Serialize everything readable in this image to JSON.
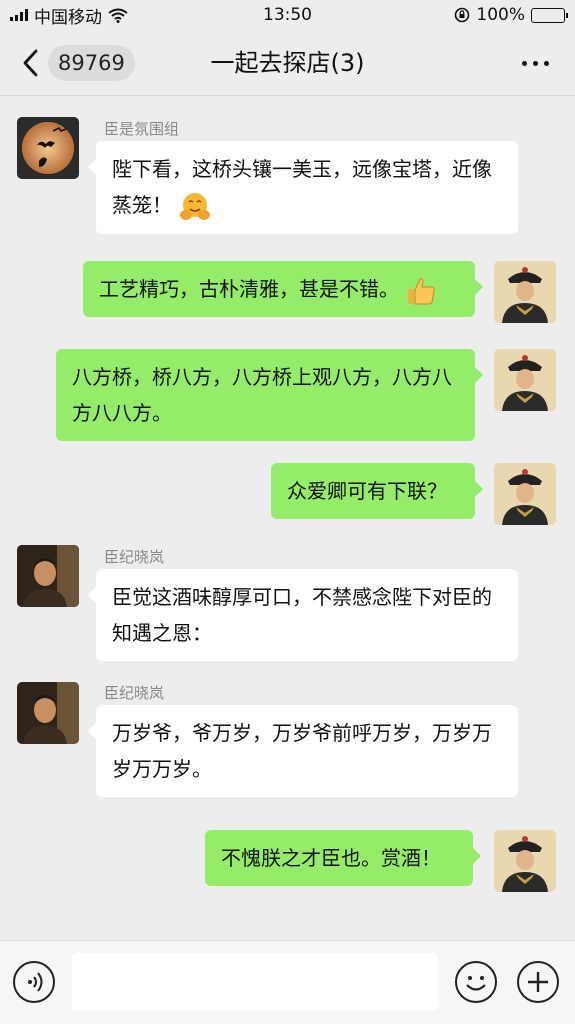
{
  "status_bar": {
    "carrier": "中国移动",
    "time": "13:50",
    "battery": "100%",
    "battery_level": 1.0
  },
  "nav": {
    "unread_count": "89769",
    "title": "一起去探店(3)"
  },
  "messages": [
    {
      "sender": "臣是氛围组",
      "text": "陛下看，这桥头镶一美玉，远像宝塔，近像蒸笼！",
      "emoji": "hug-face",
      "direction": "in"
    },
    {
      "text": "工艺精巧，古朴清雅，甚是不错。",
      "emoji": "thumbs-up",
      "direction": "out"
    },
    {
      "text": "八方桥，桥八方，八方桥上观八方，八方八方八八方。",
      "direction": "out"
    },
    {
      "text": "众爱卿可有下联？",
      "direction": "out"
    },
    {
      "sender": "臣纪晓岚",
      "text": "臣觉这酒味醇厚可口，不禁感念陛下对臣的知遇之恩：",
      "direction": "in"
    },
    {
      "sender": "臣纪晓岚",
      "text": "万岁爷，爷万岁，万岁爷前呼万岁，万岁万岁万万岁。",
      "direction": "in"
    },
    {
      "text": "不愧朕之才臣也。赏酒！",
      "direction": "out"
    }
  ],
  "colors": {
    "outgoing_bubble": "#95ec69",
    "incoming_bubble": "#ffffff",
    "background": "#ededed"
  }
}
